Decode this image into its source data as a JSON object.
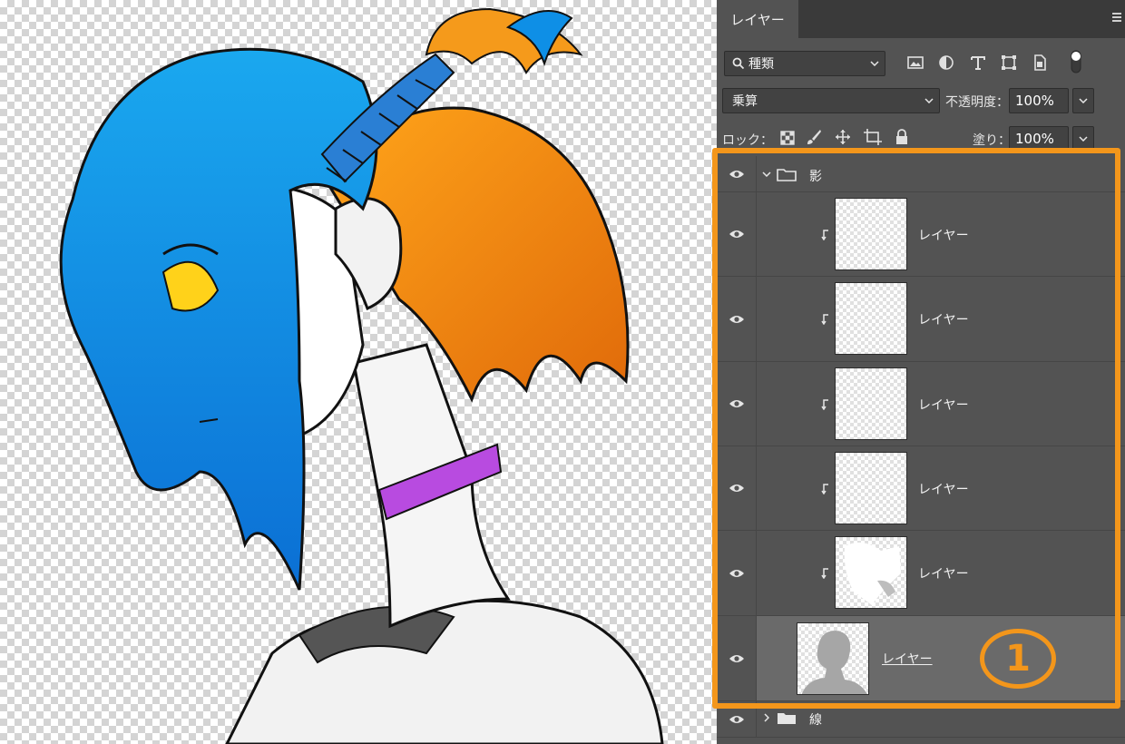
{
  "panel": {
    "tab_label": "レイヤー",
    "filter": {
      "label": "種類",
      "icons": [
        "image-filter-icon",
        "adjustment-filter-icon",
        "text-filter-icon",
        "shape-filter-icon",
        "smart-object-filter-icon",
        "filter-toggle-icon"
      ]
    },
    "blend_mode": "乗算",
    "opacity_label": "不透明度：",
    "opacity_value": "100%",
    "lock_label": "ロック：",
    "lock_icons": [
      "lock-transparency-icon",
      "lock-paint-icon",
      "lock-position-icon",
      "lock-artboard-icon",
      "lock-all-icon"
    ],
    "fill_label": "塗り：",
    "fill_value": "100%"
  },
  "layers": {
    "group_name": "影",
    "items": [
      {
        "name": "レイヤー",
        "clipped": true
      },
      {
        "name": "レイヤー",
        "clipped": true
      },
      {
        "name": "レイヤー",
        "clipped": true
      },
      {
        "name": "レイヤー",
        "clipped": true
      },
      {
        "name": "レイヤー",
        "clipped": true
      },
      {
        "name": "レイヤー",
        "clipped": false,
        "selected": true
      }
    ],
    "next_group_name": "線"
  },
  "annotation": {
    "badge": "1",
    "highlight_color": "#f3961b"
  },
  "colors": {
    "panel_bg": "#535353",
    "tabbar_bg": "#3a3a3a",
    "selected_row": "#6a6a6a",
    "accent": "#f3961b"
  }
}
